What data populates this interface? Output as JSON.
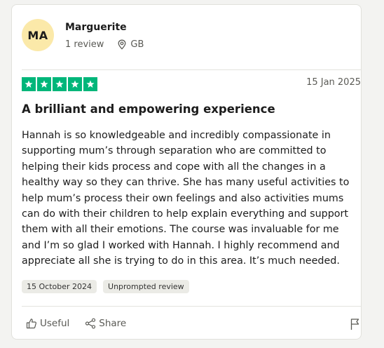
{
  "review": {
    "avatar_initials": "MA",
    "author_name": "Marguerite",
    "review_count": "1 review",
    "location": "GB",
    "rating": 5,
    "rating_color": "#00b67a",
    "date": "15 Jan 2025",
    "title": "A brilliant and empowering experience",
    "body": "Hannah is so knowledgeable and incredibly compassionate in supporting mum’s through separation who are committed to helping their kids process and cope with all the changes in a healthy way so they can thrive. She has many useful activities to help mum’s process their own feelings and also activities mums can do with their children to help explain everything and support them with all their emotions. The course was invaluable for me and I’m so glad I worked with Hannah. I highly recommend and appreciate all she is trying to do in this area. It’s much needed.",
    "experience_date": "15 October 2024",
    "tag": "Unprompted review"
  },
  "actions": {
    "useful_label": "Useful",
    "share_label": "Share",
    "icons": [
      "thumbs-up-icon",
      "share-icon",
      "flag-icon",
      "location-pin-icon",
      "star-icon"
    ]
  }
}
